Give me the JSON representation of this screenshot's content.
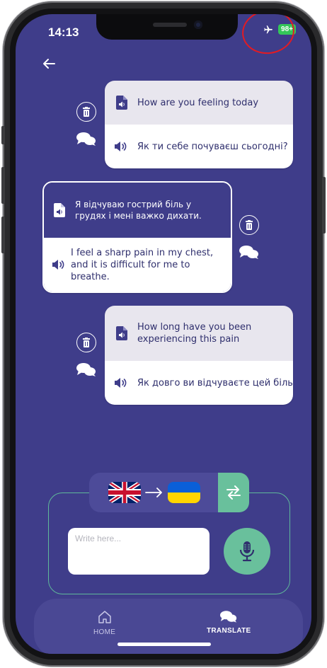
{
  "status_bar": {
    "time": "14:13",
    "battery": "98+",
    "airplane_icon": "airplane-icon"
  },
  "navigation": {
    "back_icon": "back-arrow-icon"
  },
  "messages": [
    {
      "source_text": "How are you feeling today",
      "translated_text": "Як ти себе почуваєш сьогодні?",
      "direction": "incoming"
    },
    {
      "source_text": "Я відчуваю гострий біль у грудях і мені важко дихати.",
      "translated_text": "I feel a sharp pain in my chest, and it is difficult for me to breathe.",
      "direction": "outgoing"
    },
    {
      "source_text": "How long have you been experiencing this pain",
      "translated_text": "Як довго ви відчуваєте цей біль",
      "direction": "incoming"
    }
  ],
  "composer": {
    "placeholder": "Write here...",
    "value": "",
    "from_language_flag": "uk-flag-icon",
    "to_language_flag": "ukraine-flag-icon",
    "swap_icon": "swap-icon",
    "mic_icon": "microphone-icon"
  },
  "bottom_nav": {
    "items": [
      {
        "label": "HOME",
        "icon": "home-icon",
        "active": false
      },
      {
        "label": "TRANSLATE",
        "icon": "chat-bubbles-icon",
        "active": true
      }
    ]
  },
  "colors": {
    "background": "#3f3d8a",
    "accent_green": "#69c09c",
    "card_top": "#e8e6ee",
    "text_dark": "#2f2f6d",
    "annotation_red": "#e31b23"
  }
}
